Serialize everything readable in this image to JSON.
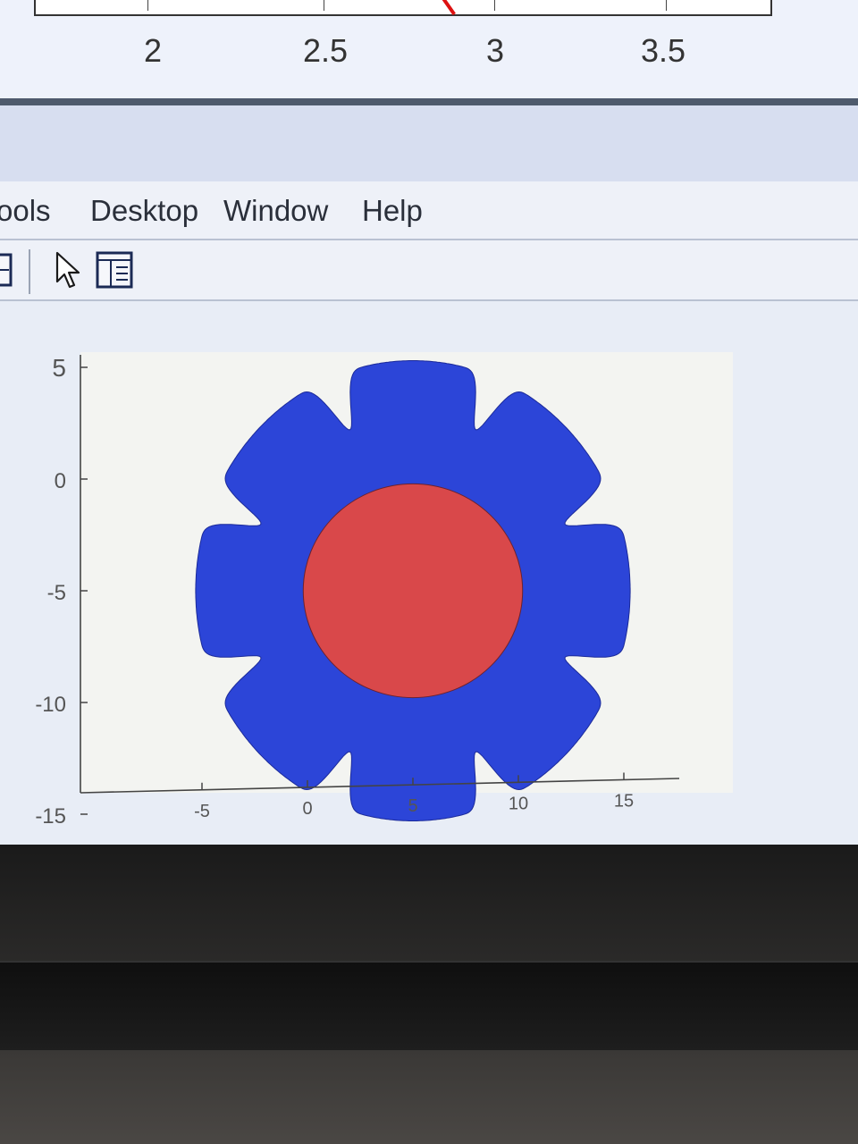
{
  "top_figure": {
    "tick_labels": [
      "2",
      "2.5",
      "3",
      "3.5"
    ]
  },
  "menu": {
    "items": [
      "ools",
      "Desktop",
      "Window",
      "Help"
    ]
  },
  "toolbar": {
    "icons": [
      "docking-icon",
      "pointer-arrow-icon",
      "property-inspector-icon"
    ]
  },
  "chart_data": {
    "type": "area",
    "xlabel": "",
    "ylabel": "",
    "xlim": [
      -7,
      17.5
    ],
    "ylim": [
      -15,
      5.5
    ],
    "x_ticks": [
      -5,
      0,
      5,
      10,
      15
    ],
    "y_ticks": [
      5,
      0,
      -5,
      -10,
      -15
    ],
    "x_tick_labels": [
      "-5",
      "0",
      "5",
      "10",
      "15"
    ],
    "y_tick_labels": [
      "5",
      "0",
      "-5",
      "-10",
      "-15"
    ],
    "grid": false,
    "series": [
      {
        "shape": "gear",
        "center": [
          5,
          -5
        ],
        "outer_radius": 10.3,
        "inner_radius": 7.8,
        "teeth": 8,
        "color": "#2c45d8"
      },
      {
        "shape": "circle",
        "center": [
          5,
          -5
        ],
        "radius": 5.2,
        "color": "#d9484a"
      }
    ]
  },
  "colors": {
    "gear": "#2c45d8",
    "disc": "#d9484a",
    "axes_bg": "#f3f4f1"
  }
}
